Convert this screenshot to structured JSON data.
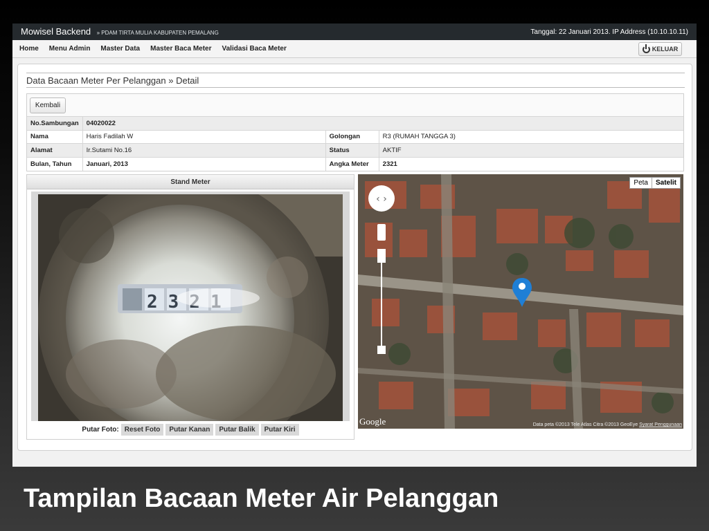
{
  "topbar": {
    "app_title": "Mowisel Backend",
    "app_subtitle": "» PDAM TIRTA MULIA KABUPATEN PEMALANG",
    "info": "Tanggal: 22 Januari 2013. IP Address (10.10.10.11)"
  },
  "nav": {
    "items": [
      "Home",
      "Menu Admin",
      "Master Data",
      "Master Baca Meter",
      "Validasi Baca Meter"
    ],
    "logout_label": "KELUAR"
  },
  "page": {
    "title": "Data Bacaan Meter Per Pelanggan » Detail",
    "back_label": "Kembali"
  },
  "details": {
    "no_sambungan_label": "No.Sambungan",
    "no_sambungan": "04020022",
    "nama_label": "Nama",
    "nama": "Haris Fadilah W",
    "golongan_label": "Golongan",
    "golongan": "R3 (RUMAH TANGGA 3)",
    "alamat_label": "Alamat",
    "alamat": "Ir.Sutami No.16",
    "status_label": "Status",
    "status": "AKTIF",
    "bulan_label": "Bulan, Tahun",
    "bulan": "Januari, 2013",
    "angka_label": "Angka Meter",
    "angka": "2321"
  },
  "stand": {
    "header": "Stand Meter",
    "rotate_label": "Putar Foto:",
    "buttons": [
      "Reset Foto",
      "Putar Kanan",
      "Putar Balik",
      "Putar Kiri"
    ],
    "meter_digits": "2321"
  },
  "map": {
    "type_map": "Peta",
    "type_satellite": "Satelit",
    "google": "Google",
    "footer": "Data peta ©2013 Tele Atlas Citra ©2013 GeoEye",
    "terms": "Syarat Penggunaan"
  },
  "caption": "Tampilan Bacaan Meter Air Pelanggan",
  "colors": {
    "topbar": "#252a2e",
    "accent_red": "#cc0000",
    "marker": "#1f7fd6"
  }
}
